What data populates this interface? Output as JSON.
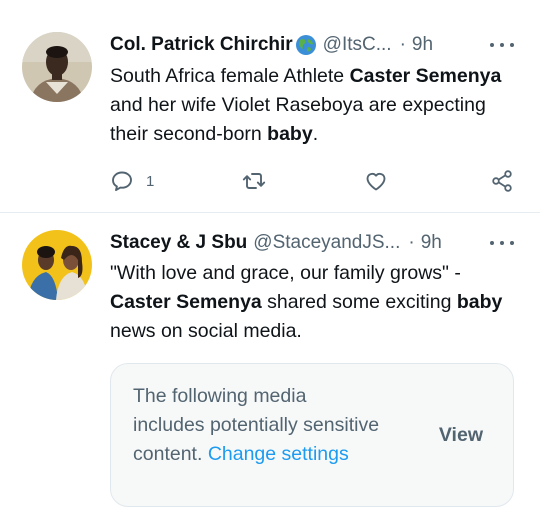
{
  "tweets": [
    {
      "name": "Col. Patrick Chirchir",
      "handle": "@ItsC...",
      "dot": "·",
      "time": "9h",
      "text_parts": [
        "South Africa female Athlete ",
        "Caster Semenya",
        " and her wife Violet Raseboya are expecting their second-born ",
        "baby",
        "."
      ],
      "reply_count": "1"
    },
    {
      "name": "Stacey & J Sbu",
      "handle": "@StaceyandJS...",
      "dot": "·",
      "time": "9h",
      "text_parts": [
        "\"With love and grace, our family grows\" - ",
        "Caster Semenya",
        " shared some exciting ",
        "baby",
        " news on social media."
      ],
      "sensitive": {
        "message": "The following media includes potentially sensitive content. ",
        "link": "Change settings",
        "view": "View"
      }
    }
  ],
  "icons": {
    "reply": "reply-icon",
    "retweet": "retweet-icon",
    "like": "heart-icon",
    "share": "share-icon",
    "more": "more-icon",
    "globe": "globe-icon"
  },
  "colors": {
    "text": "#0f1419",
    "secondary": "#536471",
    "link": "#1d9bf0"
  }
}
